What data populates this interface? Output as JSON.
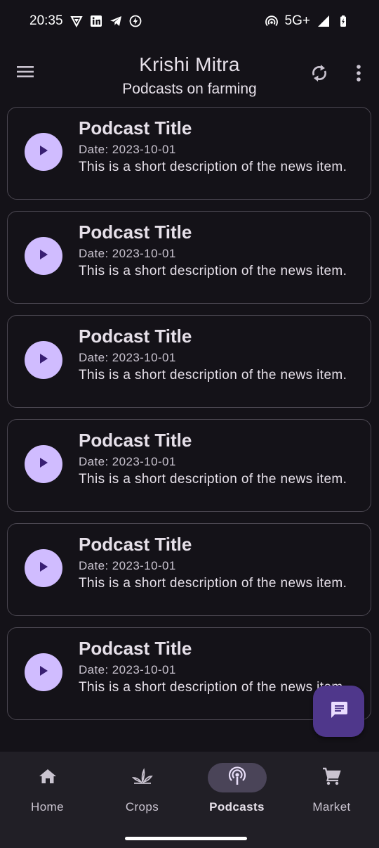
{
  "status_bar": {
    "time": "20:35",
    "network": "5G+",
    "left_icons": [
      "vpn-icon",
      "linkedin-icon",
      "telegram-icon",
      "bolt-icon"
    ],
    "right_icons": [
      "hotspot-icon",
      "signal-icon",
      "battery-icon"
    ]
  },
  "app_bar": {
    "title": "Krishi Mitra",
    "subtitle": "Podcasts on farming",
    "icons": [
      "menu-icon",
      "refresh-icon",
      "more-vert-icon"
    ]
  },
  "podcasts": [
    {
      "title": "Podcast Title",
      "date": "Date: 2023-10-01",
      "description": "This is a short description of the news item."
    },
    {
      "title": "Podcast Title",
      "date": "Date: 2023-10-01",
      "description": "This is a short description of the news item."
    },
    {
      "title": "Podcast Title",
      "date": "Date: 2023-10-01",
      "description": "This is a short description of the news item."
    },
    {
      "title": "Podcast Title",
      "date": "Date: 2023-10-01",
      "description": "This is a short description of the news item."
    },
    {
      "title": "Podcast Title",
      "date": "Date: 2023-10-01",
      "description": "This is a short description of the news item."
    },
    {
      "title": "Podcast Title",
      "date": "Date: 2023-10-01",
      "description": "This is a short description of the news item."
    }
  ],
  "fab": {
    "icon": "chat-icon"
  },
  "bottom_nav": {
    "items": [
      {
        "label": "Home",
        "icon": "home-icon",
        "active": false
      },
      {
        "label": "Crops",
        "icon": "crops-icon",
        "active": false
      },
      {
        "label": "Podcasts",
        "icon": "podcast-icon",
        "active": true
      },
      {
        "label": "Market",
        "icon": "cart-icon",
        "active": false
      }
    ]
  },
  "colors": {
    "background": "#141218",
    "play_button": "#D0BCFF",
    "fab": "#4F378B",
    "nav_background": "#211F26",
    "nav_indicator": "#4A4458",
    "card_border": "#4A4650"
  }
}
